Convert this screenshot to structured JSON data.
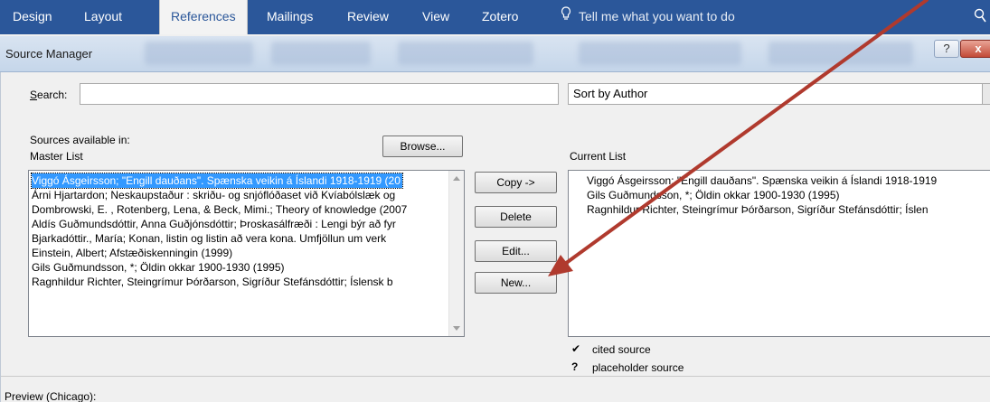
{
  "ribbon": {
    "tabs": [
      "Design",
      "Layout",
      "References",
      "Mailings",
      "Review",
      "View",
      "Zotero"
    ],
    "active_tab": "References",
    "tell_me": "Tell me what you want to do"
  },
  "dialog": {
    "title": "Source Manager",
    "help_label": "?",
    "close_label": "x",
    "search": {
      "label_prefix": "",
      "label_accel": "S",
      "label_rest": "earch:",
      "value": "",
      "placeholder": ""
    },
    "sort": {
      "selected": "Sort by Author"
    },
    "sources_available_label": "Sources available in:",
    "master_list_label": "Master List",
    "current_list_label": "Current List",
    "browse_button": "Browse...",
    "copy_button": "Copy ->",
    "delete_button": "Delete",
    "edit_button": "Edit...",
    "new_button": "New...",
    "master_list": [
      "Viggó Ásgeirsson; \"Engill dauðans\". Spænska veikin á Íslandi 1918-1919 (20",
      "Árni Hjartardon; Neskaupstaður : skriðu- og snjóflóðaset við Kvíabólslæk og",
      "Dombrowski, E. , Rotenberg, Lena, & Beck, Mimi.; Theory of knowledge (2007",
      "Aldís Guðmundsdóttir, Anna Guðjónsdóttir; Þroskasálfræði : Lengi býr að fyr",
      "Bjarkadóttir., María; Konan, listin og listin að vera kona. Umfjöllun um verk",
      "Einstein, Albert; Afstæðiskenningin (1999)",
      "Gils Guðmundsson, *; Öldin okkar 1900-1930 (1995)",
      "Ragnhildur Richter, Steingrímur Þórðarson, Sigríður Stefánsdóttir; Íslensk b"
    ],
    "current_list": [
      "Viggó Ásgeirsson; \"Engill dauðans\". Spænska veikin á Íslandi 1918-1919",
      "Gils Guðmundsson, *; Öldin okkar 1900-1930 (1995)",
      "Ragnhildur Richter, Steingrímur Þórðarson, Sigríður Stefánsdóttir; Íslen"
    ],
    "legend": [
      {
        "symbol": "✔",
        "text": "cited source"
      },
      {
        "symbol": "?",
        "text": "placeholder source"
      }
    ],
    "preview_label": "Preview (Chicago):"
  },
  "colors": {
    "ribbon": "#2b579a",
    "selection": "#3399ff",
    "annotation_arrow": "#b03a2e"
  }
}
